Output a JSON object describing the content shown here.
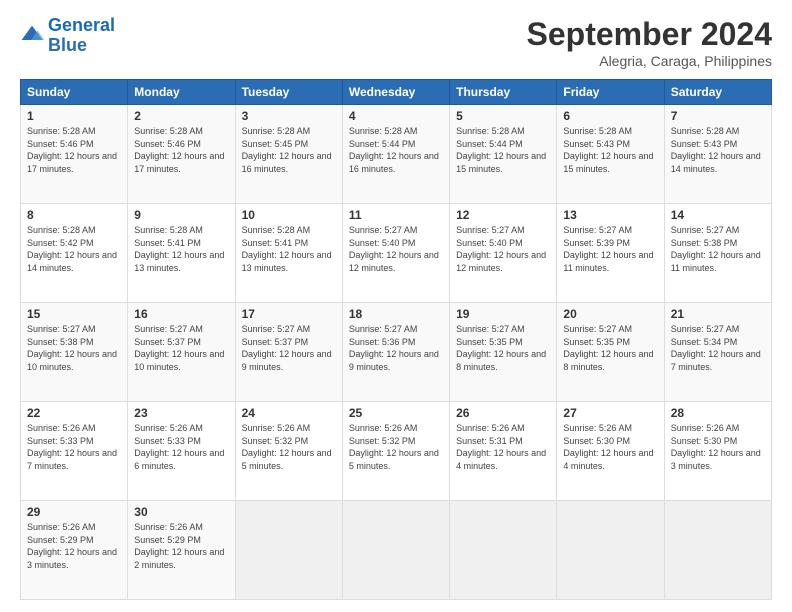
{
  "logo": {
    "line1": "General",
    "line2": "Blue"
  },
  "title": "September 2024",
  "subtitle": "Alegria, Caraga, Philippines",
  "weekdays": [
    "Sunday",
    "Monday",
    "Tuesday",
    "Wednesday",
    "Thursday",
    "Friday",
    "Saturday"
  ],
  "days": [
    {
      "num": "",
      "info": ""
    },
    {
      "num": "",
      "info": ""
    },
    {
      "num": "",
      "info": ""
    },
    {
      "num": "",
      "info": ""
    },
    {
      "num": "",
      "info": ""
    },
    {
      "num": "",
      "info": ""
    },
    {
      "num": "1",
      "sunrise": "Sunrise: 5:28 AM",
      "sunset": "Sunset: 5:46 PM",
      "daylight": "Daylight: 12 hours and 17 minutes."
    },
    {
      "num": "2",
      "sunrise": "Sunrise: 5:28 AM",
      "sunset": "Sunset: 5:46 PM",
      "daylight": "Daylight: 12 hours and 17 minutes."
    },
    {
      "num": "3",
      "sunrise": "Sunrise: 5:28 AM",
      "sunset": "Sunset: 5:45 PM",
      "daylight": "Daylight: 12 hours and 16 minutes."
    },
    {
      "num": "4",
      "sunrise": "Sunrise: 5:28 AM",
      "sunset": "Sunset: 5:44 PM",
      "daylight": "Daylight: 12 hours and 16 minutes."
    },
    {
      "num": "5",
      "sunrise": "Sunrise: 5:28 AM",
      "sunset": "Sunset: 5:44 PM",
      "daylight": "Daylight: 12 hours and 15 minutes."
    },
    {
      "num": "6",
      "sunrise": "Sunrise: 5:28 AM",
      "sunset": "Sunset: 5:43 PM",
      "daylight": "Daylight: 12 hours and 15 minutes."
    },
    {
      "num": "7",
      "sunrise": "Sunrise: 5:28 AM",
      "sunset": "Sunset: 5:43 PM",
      "daylight": "Daylight: 12 hours and 14 minutes."
    },
    {
      "num": "8",
      "sunrise": "Sunrise: 5:28 AM",
      "sunset": "Sunset: 5:42 PM",
      "daylight": "Daylight: 12 hours and 14 minutes."
    },
    {
      "num": "9",
      "sunrise": "Sunrise: 5:28 AM",
      "sunset": "Sunset: 5:41 PM",
      "daylight": "Daylight: 12 hours and 13 minutes."
    },
    {
      "num": "10",
      "sunrise": "Sunrise: 5:28 AM",
      "sunset": "Sunset: 5:41 PM",
      "daylight": "Daylight: 12 hours and 13 minutes."
    },
    {
      "num": "11",
      "sunrise": "Sunrise: 5:27 AM",
      "sunset": "Sunset: 5:40 PM",
      "daylight": "Daylight: 12 hours and 12 minutes."
    },
    {
      "num": "12",
      "sunrise": "Sunrise: 5:27 AM",
      "sunset": "Sunset: 5:40 PM",
      "daylight": "Daylight: 12 hours and 12 minutes."
    },
    {
      "num": "13",
      "sunrise": "Sunrise: 5:27 AM",
      "sunset": "Sunset: 5:39 PM",
      "daylight": "Daylight: 12 hours and 11 minutes."
    },
    {
      "num": "14",
      "sunrise": "Sunrise: 5:27 AM",
      "sunset": "Sunset: 5:38 PM",
      "daylight": "Daylight: 12 hours and 11 minutes."
    },
    {
      "num": "15",
      "sunrise": "Sunrise: 5:27 AM",
      "sunset": "Sunset: 5:38 PM",
      "daylight": "Daylight: 12 hours and 10 minutes."
    },
    {
      "num": "16",
      "sunrise": "Sunrise: 5:27 AM",
      "sunset": "Sunset: 5:37 PM",
      "daylight": "Daylight: 12 hours and 10 minutes."
    },
    {
      "num": "17",
      "sunrise": "Sunrise: 5:27 AM",
      "sunset": "Sunset: 5:37 PM",
      "daylight": "Daylight: 12 hours and 9 minutes."
    },
    {
      "num": "18",
      "sunrise": "Sunrise: 5:27 AM",
      "sunset": "Sunset: 5:36 PM",
      "daylight": "Daylight: 12 hours and 9 minutes."
    },
    {
      "num": "19",
      "sunrise": "Sunrise: 5:27 AM",
      "sunset": "Sunset: 5:35 PM",
      "daylight": "Daylight: 12 hours and 8 minutes."
    },
    {
      "num": "20",
      "sunrise": "Sunrise: 5:27 AM",
      "sunset": "Sunset: 5:35 PM",
      "daylight": "Daylight: 12 hours and 8 minutes."
    },
    {
      "num": "21",
      "sunrise": "Sunrise: 5:27 AM",
      "sunset": "Sunset: 5:34 PM",
      "daylight": "Daylight: 12 hours and 7 minutes."
    },
    {
      "num": "22",
      "sunrise": "Sunrise: 5:26 AM",
      "sunset": "Sunset: 5:33 PM",
      "daylight": "Daylight: 12 hours and 7 minutes."
    },
    {
      "num": "23",
      "sunrise": "Sunrise: 5:26 AM",
      "sunset": "Sunset: 5:33 PM",
      "daylight": "Daylight: 12 hours and 6 minutes."
    },
    {
      "num": "24",
      "sunrise": "Sunrise: 5:26 AM",
      "sunset": "Sunset: 5:32 PM",
      "daylight": "Daylight: 12 hours and 5 minutes."
    },
    {
      "num": "25",
      "sunrise": "Sunrise: 5:26 AM",
      "sunset": "Sunset: 5:32 PM",
      "daylight": "Daylight: 12 hours and 5 minutes."
    },
    {
      "num": "26",
      "sunrise": "Sunrise: 5:26 AM",
      "sunset": "Sunset: 5:31 PM",
      "daylight": "Daylight: 12 hours and 4 minutes."
    },
    {
      "num": "27",
      "sunrise": "Sunrise: 5:26 AM",
      "sunset": "Sunset: 5:30 PM",
      "daylight": "Daylight: 12 hours and 4 minutes."
    },
    {
      "num": "28",
      "sunrise": "Sunrise: 5:26 AM",
      "sunset": "Sunset: 5:30 PM",
      "daylight": "Daylight: 12 hours and 3 minutes."
    },
    {
      "num": "29",
      "sunrise": "Sunrise: 5:26 AM",
      "sunset": "Sunset: 5:29 PM",
      "daylight": "Daylight: 12 hours and 3 minutes."
    },
    {
      "num": "30",
      "sunrise": "Sunrise: 5:26 AM",
      "sunset": "Sunset: 5:29 PM",
      "daylight": "Daylight: 12 hours and 2 minutes."
    },
    {
      "num": "",
      "info": ""
    },
    {
      "num": "",
      "info": ""
    },
    {
      "num": "",
      "info": ""
    },
    {
      "num": "",
      "info": ""
    },
    {
      "num": "",
      "info": ""
    }
  ]
}
